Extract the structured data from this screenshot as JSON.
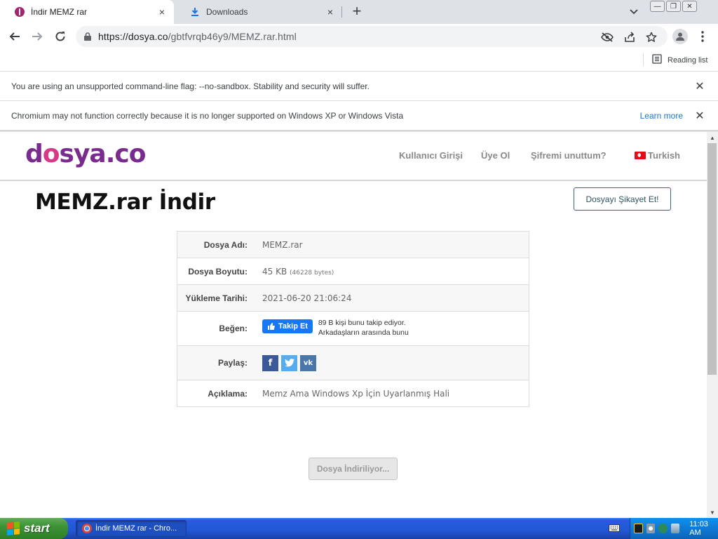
{
  "browser": {
    "tabs": [
      {
        "title": "İndir MEMZ rar",
        "close_icon": "×"
      },
      {
        "title": "Downloads",
        "close_icon": "×"
      }
    ],
    "new_tab_icon": "+",
    "window_controls": {
      "minimize": "—",
      "restore": "❐",
      "close": "✕"
    },
    "url": {
      "scheme_host": "https://dosya.co",
      "path": "/gbtfvrqb46y9/MEMZ.rar.html"
    },
    "reading_list": "Reading list"
  },
  "infobars": [
    {
      "message": "You are using an unsupported command-line flag: --no-sandbox. Stability and security will suffer.",
      "close_icon": "✕"
    },
    {
      "message": "Chromium may not function correctly because it is no longer supported on Windows XP or Windows Vista",
      "link": "Learn more",
      "close_icon": "✕"
    }
  ],
  "site": {
    "logo": {
      "d": "d",
      "o": "o",
      "rest": "sya.co"
    },
    "nav": {
      "login": "Kullanıcı Girişi",
      "signup": "Üye Ol",
      "forgot": "Şifremi unuttum?",
      "language": "Turkish"
    },
    "heading": "MEMZ.rar İndir",
    "complain_button": "Dosyayı Şikayet Et!",
    "table": {
      "name_label": "Dosya Adı:",
      "name_value": "MEMZ.rar",
      "size_label": "Dosya Boyutu:",
      "size_value": "45 KB",
      "size_bytes": "(46228 bytes)",
      "date_label": "Yükleme Tarihi:",
      "date_value": "2021-06-20 21:06:24",
      "like_label": "Beğen:",
      "follow_button": "Takip Et",
      "follow_line1": "89 B kişi bunu takip ediyor.",
      "follow_line2": "Arkadaşların arasında bunu",
      "share_label": "Paylaş:",
      "share_facebook": "f",
      "share_vk": "vk",
      "desc_label": "Açıklama:",
      "desc_value": "Memz Ama Windows Xp İçin Uyarlanmış Hali"
    },
    "download_button": "Dosya İndiriliyor..."
  },
  "taskbar": {
    "start": "start",
    "task_item": "İndir MEMZ rar - Chro...",
    "clock": "11:03 AM"
  },
  "colors": {
    "brand_purple": "#7a2b8e",
    "brand_pink": "#d63a86",
    "facebook_blue": "#3b5998",
    "twitter_blue": "#55acee",
    "vk_blue": "#4a76a8"
  }
}
